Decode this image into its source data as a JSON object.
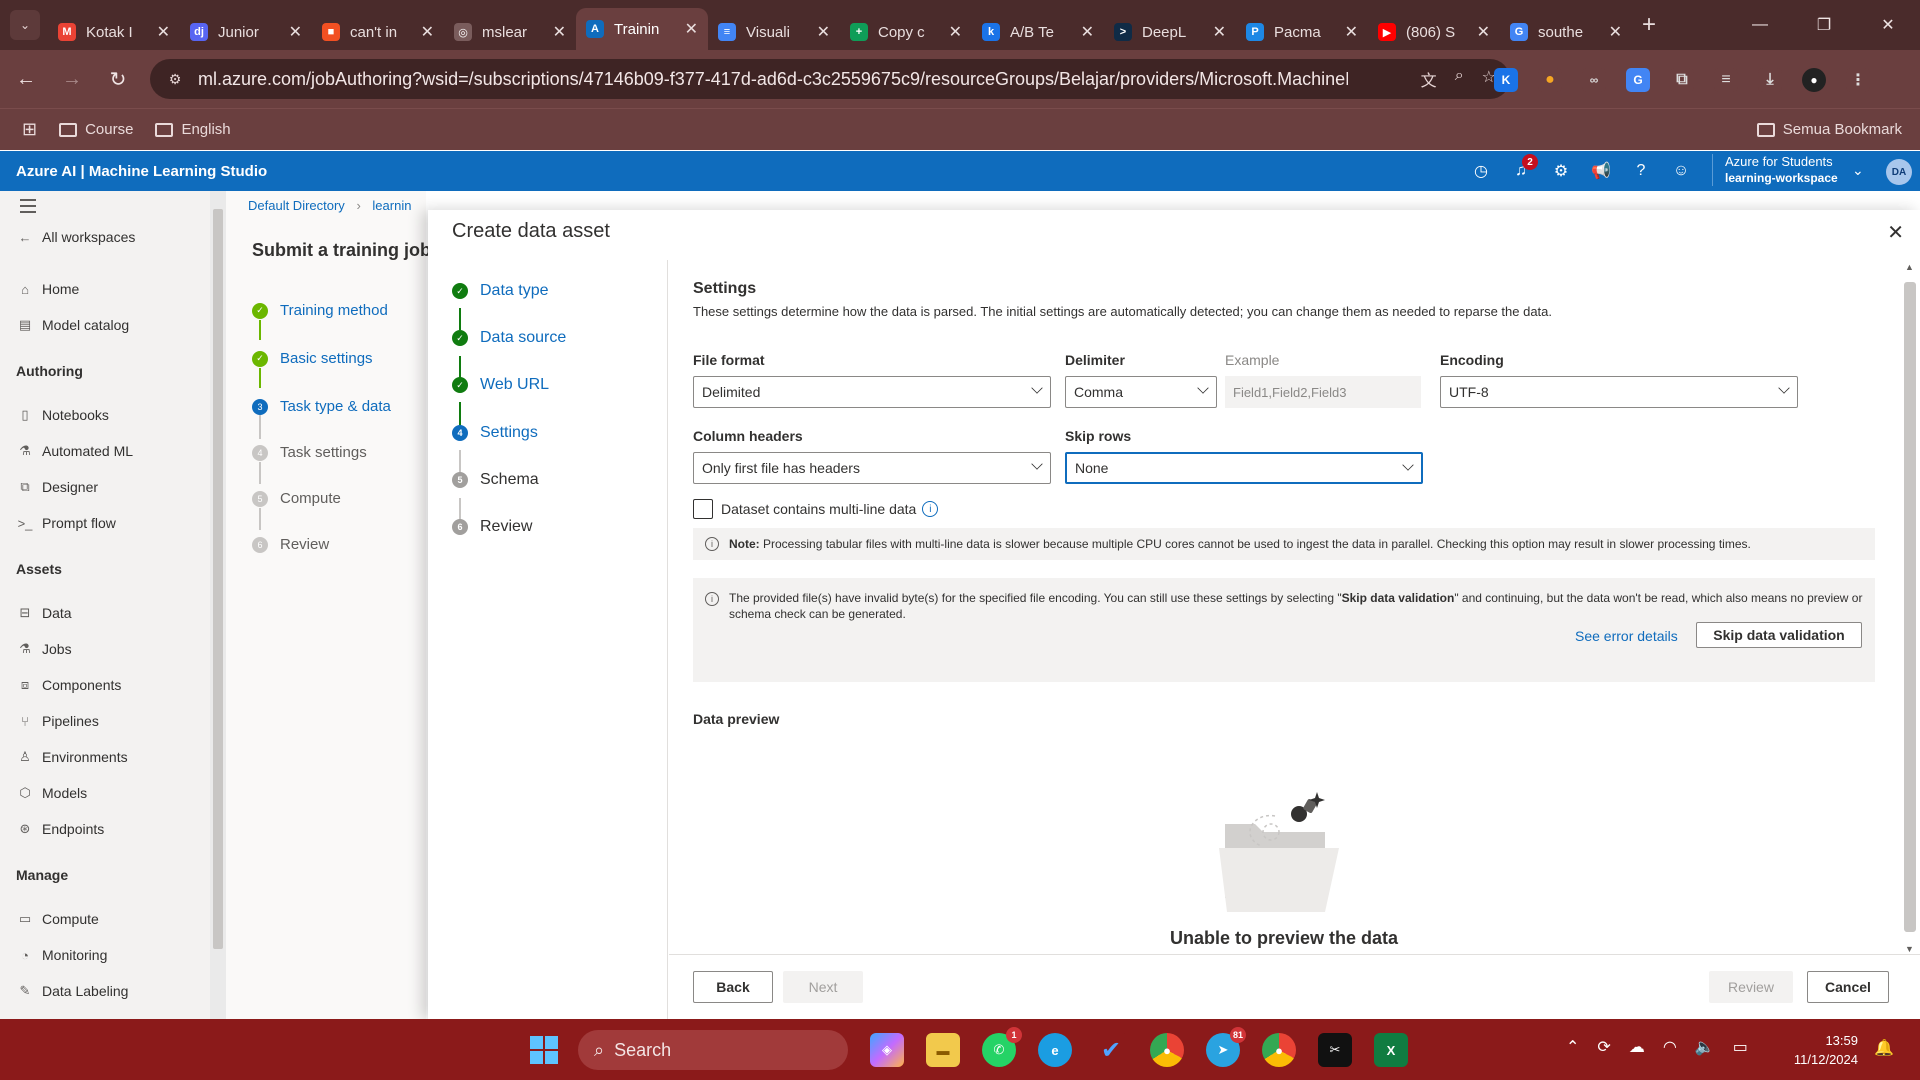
{
  "browser": {
    "tabs": [
      {
        "label": "Kotak I",
        "icon": "gmail-icon",
        "color": "#ea4335",
        "glyph": "M"
      },
      {
        "label": "Junior",
        "icon": "dj-icon",
        "color": "#5865f2",
        "glyph": "dj"
      },
      {
        "label": "can't in",
        "icon": "microsoft-icon",
        "color": "#f25022",
        "glyph": "■"
      },
      {
        "label": "mslear",
        "icon": "globe-icon",
        "color": "#7a5c5c",
        "glyph": "◎"
      },
      {
        "label": "Trainin",
        "icon": "azure-ml-icon",
        "color": "#0f6cbd",
        "glyph": "A",
        "active": true
      },
      {
        "label": "Visuali",
        "icon": "docs-icon",
        "color": "#4285f4",
        "glyph": "≡"
      },
      {
        "label": "Copy c",
        "icon": "sheets-plus-icon",
        "color": "#0f9d58",
        "glyph": "+"
      },
      {
        "label": "A/B Te",
        "icon": "k-icon",
        "color": "#1a73e8",
        "glyph": "k"
      },
      {
        "label": "DeepL",
        "icon": "deepl-icon",
        "color": "#0f2b46",
        "glyph": ">"
      },
      {
        "label": "Pacma",
        "icon": "p-icon",
        "color": "#1e88e5",
        "glyph": "P"
      },
      {
        "label": "(806) S",
        "icon": "youtube-icon",
        "color": "#ff0000",
        "glyph": "▶"
      },
      {
        "label": "southe",
        "icon": "google-icon",
        "color": "#4285f4",
        "glyph": "G"
      }
    ],
    "url": "ml.azure.com/jobAuthoring?wsid=/subscriptions/47146b09-f377-417d-ad6d-c3c2559675c9/resourceGroups/Belajar/providers/Microsoft.MachineL...",
    "bookmarks": [
      "Course",
      "English"
    ],
    "bookmarks_right": "Semua Bookmark"
  },
  "azure": {
    "brand": "Azure AI | Machine Learning Studio",
    "notification_count": "2",
    "account_line1": "Azure for Students",
    "account_line2": "learning-workspace",
    "avatar": "DA"
  },
  "leftnav": {
    "all_workspaces": "All workspaces",
    "home": "Home",
    "model_catalog": "Model catalog",
    "section_authoring": "Authoring",
    "notebooks": "Notebooks",
    "automated_ml": "Automated ML",
    "designer": "Designer",
    "prompt_flow": "Prompt flow",
    "section_assets": "Assets",
    "data": "Data",
    "jobs": "Jobs",
    "components": "Components",
    "pipelines": "Pipelines",
    "environments": "Environments",
    "models": "Models",
    "endpoints": "Endpoints",
    "section_manage": "Manage",
    "compute": "Compute",
    "monitoring": "Monitoring",
    "data_labeling": "Data Labeling"
  },
  "background_page": {
    "breadcrumb_1": "Default Directory",
    "breadcrumb_2": "learnin",
    "title": "Submit a training job",
    "steps": [
      "Training method",
      "Basic settings",
      "Task type & data",
      "Task settings",
      "Compute",
      "Review"
    ]
  },
  "panel": {
    "title": "Create data asset",
    "wizard_steps": [
      "Data type",
      "Data source",
      "Web URL",
      "Settings",
      "Schema",
      "Review"
    ],
    "settings_heading": "Settings",
    "settings_desc": "These settings determine how the data is parsed. The initial settings are automatically detected; you can change them as needed to reparse the data.",
    "file_format_label": "File format",
    "file_format_value": "Delimited",
    "delimiter_label": "Delimiter",
    "delimiter_value": "Comma",
    "example_label": "Example",
    "example_value": "Field1,Field2,Field3",
    "encoding_label": "Encoding",
    "encoding_value": "UTF-8",
    "column_headers_label": "Column headers",
    "column_headers_value": "Only first file has headers",
    "skip_rows_label": "Skip rows",
    "skip_rows_value": "None",
    "multiline_label": "Dataset contains multi-line data",
    "note_bold": "Note:",
    "note_text": " Processing tabular files with multi-line data is slower because multiple CPU cores cannot be used to ingest the data in parallel. Checking this option may result in slower processing times.",
    "warning_pre": "The provided file(s) have invalid byte(s) for the specified file encoding. You can still use these settings by selecting \"",
    "warning_bold": "Skip data validation",
    "warning_post": "\" and continuing, but the data won't be read, which also means no preview or schema check can be generated.",
    "see_error_details": "See error details",
    "skip_validation_button": "Skip data validation",
    "data_preview_heading": "Data preview",
    "empty_state": "Unable to preview the data",
    "back_button": "Back",
    "next_button": "Next",
    "review_button": "Review",
    "cancel_button": "Cancel"
  },
  "taskbar": {
    "search_placeholder": "Search",
    "whatsapp_badge": "1",
    "telegram_badge": "81",
    "time": "13:59",
    "date": "11/12/2024"
  }
}
